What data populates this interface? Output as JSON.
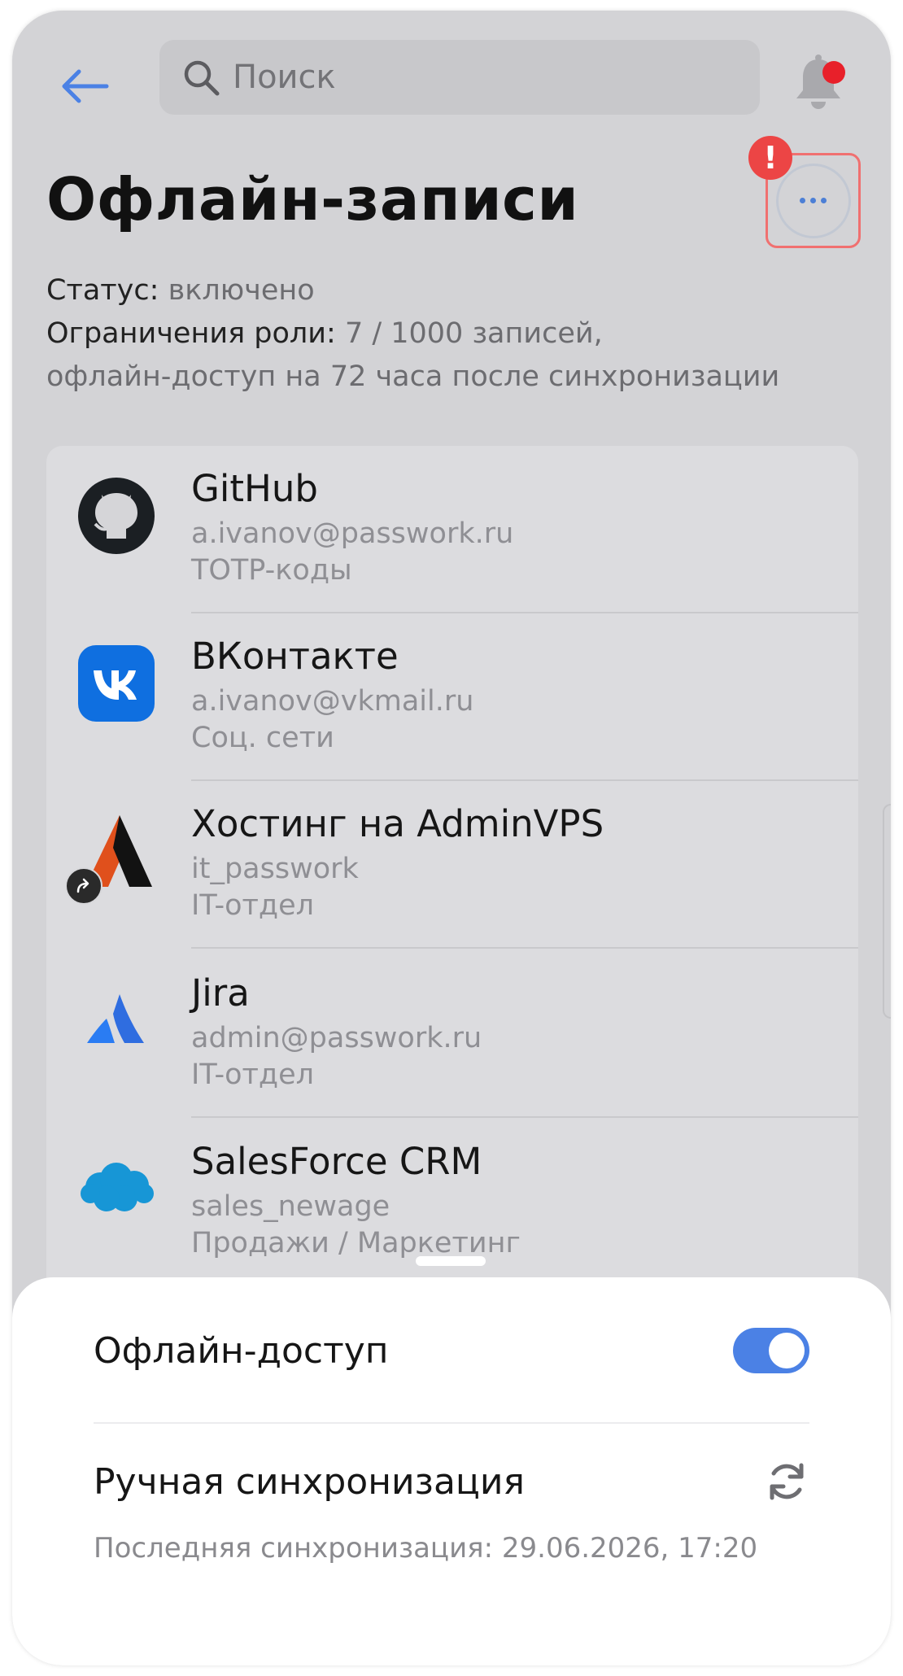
{
  "search": {
    "placeholder": "Поиск"
  },
  "page": {
    "title": "Офлайн-записи",
    "status_label": "Статус:",
    "status_value": "включено",
    "limits_label": "Ограничения роли:",
    "limits_value": "7 / 1000 записей,",
    "limits_note": "офлайн-доступ на 72 часа после синхронизации",
    "alert_mark": "!"
  },
  "items": [
    {
      "name": "GitHub",
      "login": "a.ivanov@passwork.ru",
      "folder": "TOTP-коды",
      "icon": "github-icon"
    },
    {
      "name": "ВКонтакте",
      "login": "a.ivanov@vkmail.ru",
      "folder": "Соц. сети",
      "icon": "vk-icon"
    },
    {
      "name": "Хостинг на AdminVPS",
      "login": "it_passwork",
      "folder": "IT-отдел",
      "icon": "adminvps-icon",
      "shared": true
    },
    {
      "name": "Jira",
      "login": "admin@passwork.ru",
      "folder": "IT-отдел",
      "icon": "jira-icon"
    },
    {
      "name": "SalesForce CRM",
      "login": "sales_newage",
      "folder": "Продажи / Маркетинг",
      "icon": "salesforce-icon"
    }
  ],
  "sheet": {
    "offline_access_label": "Офлайн-доступ",
    "offline_access_enabled": true,
    "manual_sync_label": "Ручная синхронизация",
    "last_sync": "Последняя синхронизация: 29.06.2026, 17:20"
  },
  "colors": {
    "accent": "#4b81e5",
    "alert": "#ec4545",
    "notification_dot": "#e8202a"
  }
}
